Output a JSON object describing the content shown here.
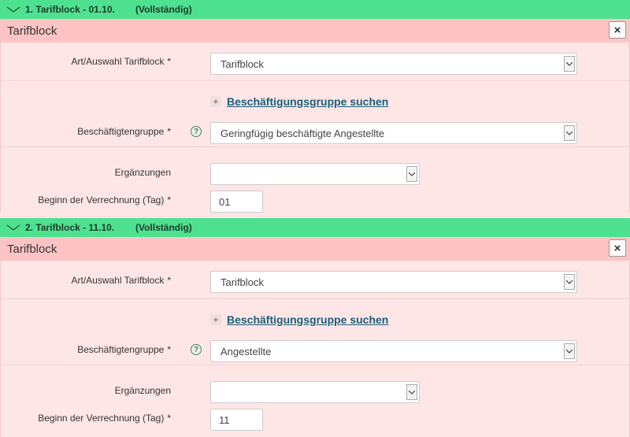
{
  "blocks": [
    {
      "header_title": "1. Tarifblock - 01.10.",
      "header_status": "(Vollständig)",
      "panel_title": "Tarifblock",
      "close_label": "×",
      "art_label": "Art/Auswahl Tarifblock",
      "art_value": "Tarifblock",
      "search_link": "Beschäftigungsgruppe suchen",
      "gruppe_label": "Beschäftigtengruppe",
      "gruppe_value": "Geringfügig beschäftigte Angestellte",
      "ergaenzungen_label": "Ergänzungen",
      "ergaenzungen_value": "",
      "beginn_label": "Beginn der Verrechnung (Tag)",
      "beginn_value": "01"
    },
    {
      "header_title": "2. Tarifblock - 11.10.",
      "header_status": "(Vollständig)",
      "panel_title": "Tarifblock",
      "close_label": "×",
      "art_label": "Art/Auswahl Tarifblock",
      "art_value": "Tarifblock",
      "search_link": "Beschäftigungsgruppe suchen",
      "gruppe_label": "Beschäftigtengruppe",
      "gruppe_value": "Angestellte",
      "ergaenzungen_label": "Ergänzungen",
      "ergaenzungen_value": "",
      "beginn_label": "Beginn der Verrechnung (Tag)",
      "beginn_value": "11"
    }
  ],
  "required_marker": "*",
  "help_glyph": "?",
  "plus_glyph": "+",
  "colors": {
    "header_green": "#4ee18f",
    "panel_title_bg": "#ffc3c3",
    "panel_bg": "#ffe6e6",
    "link": "#1b5e7a"
  }
}
